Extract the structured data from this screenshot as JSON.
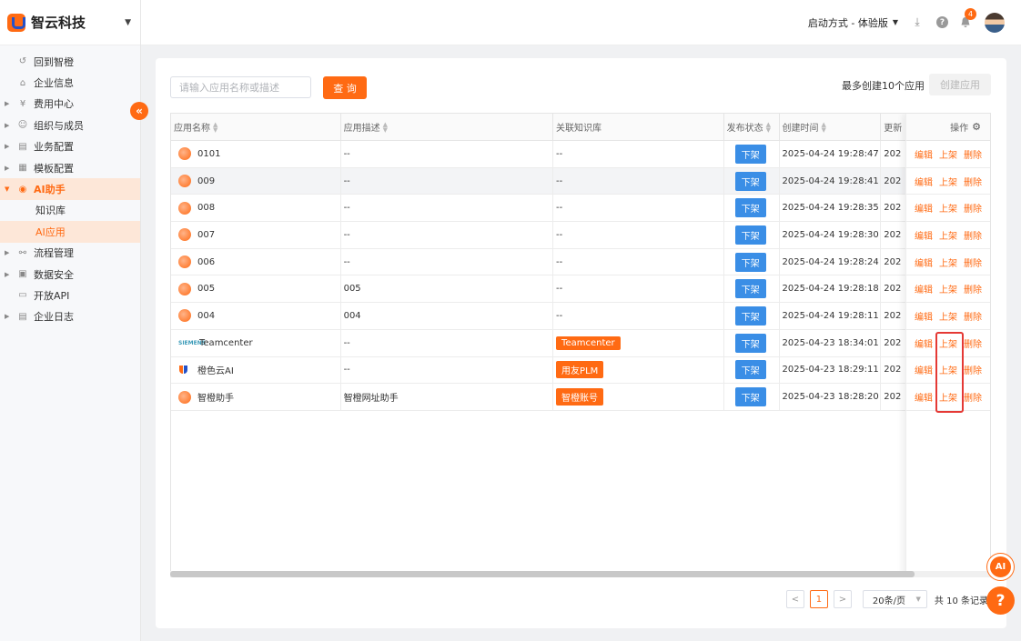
{
  "brand": {
    "name": "智云科技"
  },
  "sidebar": {
    "items": [
      {
        "label": "回到智橙",
        "icon": "return-icon"
      },
      {
        "label": "企业信息",
        "icon": "home-icon"
      },
      {
        "label": "费用中心",
        "icon": "yen-icon"
      },
      {
        "label": "组织与成员",
        "icon": "users-icon"
      },
      {
        "label": "业务配置",
        "icon": "config-icon"
      },
      {
        "label": "模板配置",
        "icon": "template-icon"
      },
      {
        "label": "AI助手",
        "icon": "robot-icon"
      },
      {
        "label": "知识库"
      },
      {
        "label": "AI应用"
      },
      {
        "label": "流程管理",
        "icon": "flow-icon"
      },
      {
        "label": "数据安全",
        "icon": "data-icon"
      },
      {
        "label": "开放API",
        "icon": "api-icon"
      },
      {
        "label": "企业日志",
        "icon": "log-icon"
      }
    ]
  },
  "header": {
    "startup_mode": "启动方式 - 体验版",
    "notification_count": "4"
  },
  "toolbar": {
    "search_placeholder": "请输入应用名称或描述",
    "query_label": "查 询",
    "limit_text": "最多创建10个应用",
    "create_label": "创建应用"
  },
  "table": {
    "columns": [
      "应用名称",
      "应用描述",
      "关联知识库",
      "发布状态",
      "创建时间",
      "更新",
      "操作"
    ],
    "rows": [
      {
        "name": "0101",
        "desc": "--",
        "kb": "--",
        "status": "下架",
        "created": "2025-04-24 19:28:47",
        "updated": "202"
      },
      {
        "name": "009",
        "desc": "--",
        "kb": "--",
        "status": "下架",
        "created": "2025-04-24 19:28:41",
        "updated": "202"
      },
      {
        "name": "008",
        "desc": "--",
        "kb": "--",
        "status": "下架",
        "created": "2025-04-24 19:28:35",
        "updated": "202"
      },
      {
        "name": "007",
        "desc": "--",
        "kb": "--",
        "status": "下架",
        "created": "2025-04-24 19:28:30",
        "updated": "202"
      },
      {
        "name": "006",
        "desc": "--",
        "kb": "--",
        "status": "下架",
        "created": "2025-04-24 19:28:24",
        "updated": "202"
      },
      {
        "name": "005",
        "desc": "005",
        "kb": "--",
        "status": "下架",
        "created": "2025-04-24 19:28:18",
        "updated": "202"
      },
      {
        "name": "004",
        "desc": "004",
        "kb": "--",
        "status": "下架",
        "created": "2025-04-24 19:28:11",
        "updated": "202"
      },
      {
        "name": "Teamcenter",
        "desc": "--",
        "kb": "Teamcenter",
        "status": "下架",
        "created": "2025-04-23 18:34:01",
        "updated": "202"
      },
      {
        "name": "橙色云AI",
        "desc": "--",
        "kb": "用友PLM",
        "status": "下架",
        "created": "2025-04-23 18:29:11",
        "updated": "202"
      },
      {
        "name": "智橙助手",
        "desc": "智橙网址助手",
        "kb": "智橙账号",
        "status": "下架",
        "created": "2025-04-23 18:28:20",
        "updated": "202"
      }
    ],
    "actions": {
      "edit": "编辑",
      "publish": "上架",
      "delete": "删除"
    }
  },
  "pagination": {
    "prev": "<",
    "current": "1",
    "next": ">",
    "page_size": "20条/页",
    "total": "共 10 条记录"
  },
  "colors": {
    "accent": "#ff6a13",
    "status_blue": "#3a8ee6",
    "highlight_red": "#e53935"
  }
}
